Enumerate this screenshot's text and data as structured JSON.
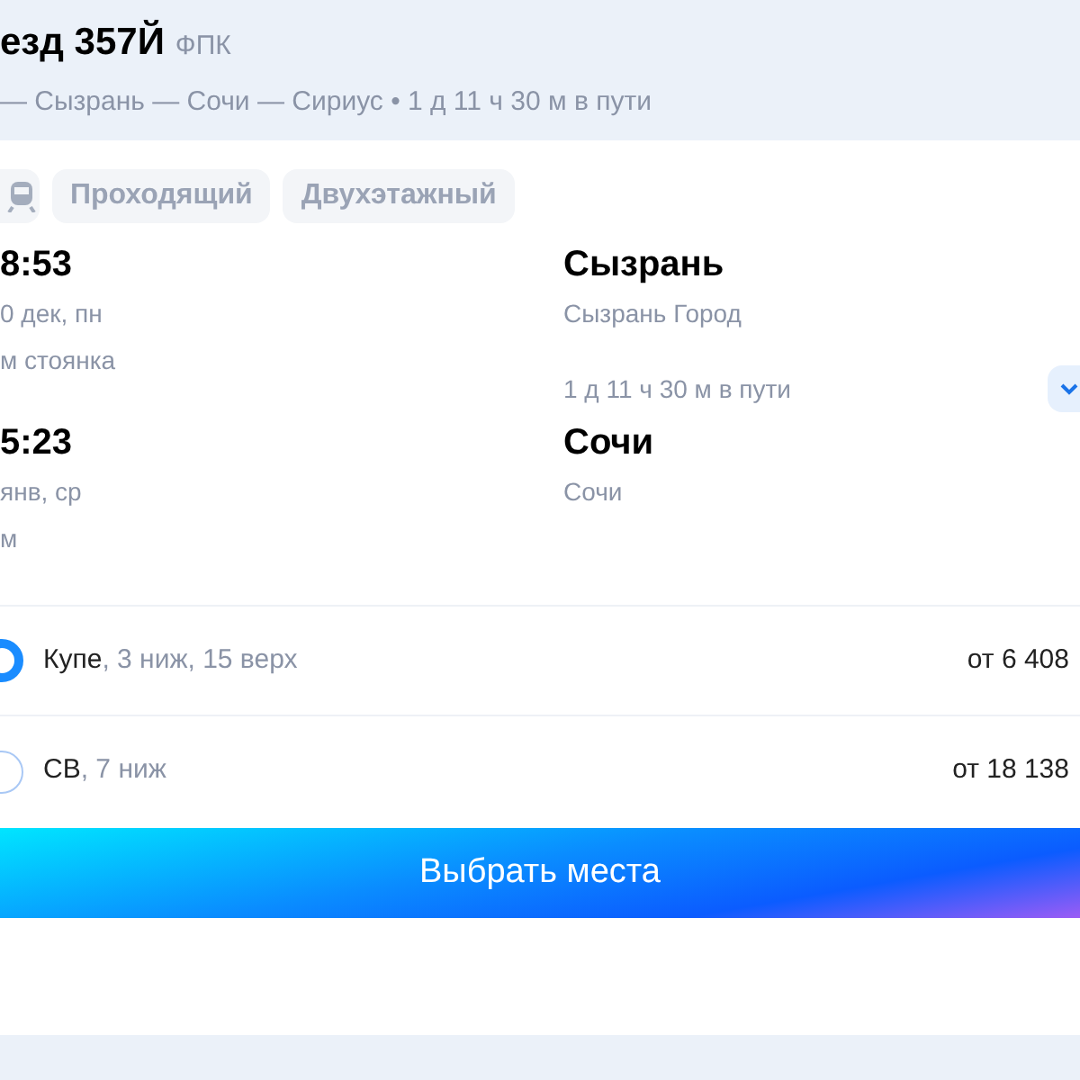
{
  "header": {
    "title": "езд 357Й",
    "carrier": "ФПК",
    "route": "— Сызрань — Сочи — Сириус • 1 д 11 ч 30 м в пути"
  },
  "tags": [
    {
      "label": "Проходящий"
    },
    {
      "label": "Двухэтажный"
    }
  ],
  "departure": {
    "time": "8:53",
    "date": "0 дек, пн",
    "note": "м стоянка",
    "city": "Сызрань",
    "station": "Сызрань Город"
  },
  "duration": "1 д 11 ч 30 м в пути",
  "arrival": {
    "time": "5:23",
    "date": "янв, ср",
    "note": "м",
    "city": "Сочи",
    "station": "Сочи"
  },
  "options": [
    {
      "name": "Купе",
      "details": ", 3 ниж, 15 верх",
      "price": "от 6 408",
      "selected": true
    },
    {
      "name": "СВ",
      "details": ", 7 ниж",
      "price": "от 18 138",
      "selected": false
    }
  ],
  "button": "Выбрать места"
}
